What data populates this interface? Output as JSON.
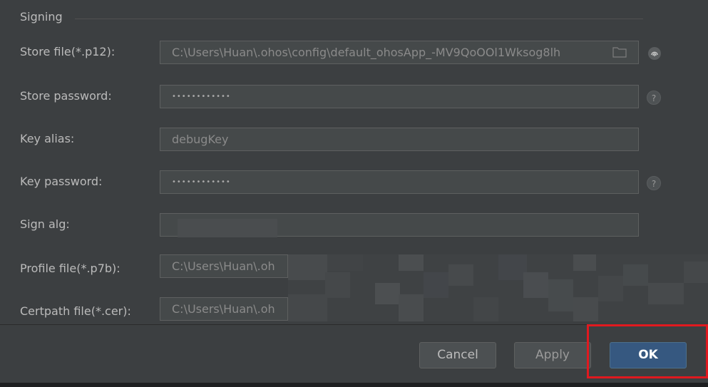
{
  "section": {
    "title": "Signing"
  },
  "fields": {
    "store_file": {
      "label": "Store file(*.p12):",
      "value": "C:\\Users\\Huan\\.ohos\\config\\default_ohosApp_-MV9QoOOl1Wksog8lh"
    },
    "store_password": {
      "label": "Store password:",
      "value": "••••••••••••"
    },
    "key_alias": {
      "label": "Key alias:",
      "value": "debugKey"
    },
    "key_password": {
      "label": "Key password:",
      "value": "••••••••••••"
    },
    "sign_alg": {
      "label": "Sign alg:",
      "value": ""
    },
    "profile_file": {
      "label": "Profile file(*.p7b):",
      "value": "C:\\Users\\Huan\\.oh"
    },
    "certpath_file": {
      "label": "Certpath file(*.cer):",
      "value": "C:\\Users\\Huan\\.oh"
    }
  },
  "icons": {
    "help": "?",
    "folder": "folder-icon",
    "fingerprint": "fingerprint-icon"
  },
  "buttons": {
    "cancel": "Cancel",
    "apply": "Apply",
    "ok": "OK"
  },
  "colors": {
    "background": "#3c3f41",
    "field_bg": "#45494a",
    "primary_button": "#365880",
    "highlight": "#e0191f"
  }
}
